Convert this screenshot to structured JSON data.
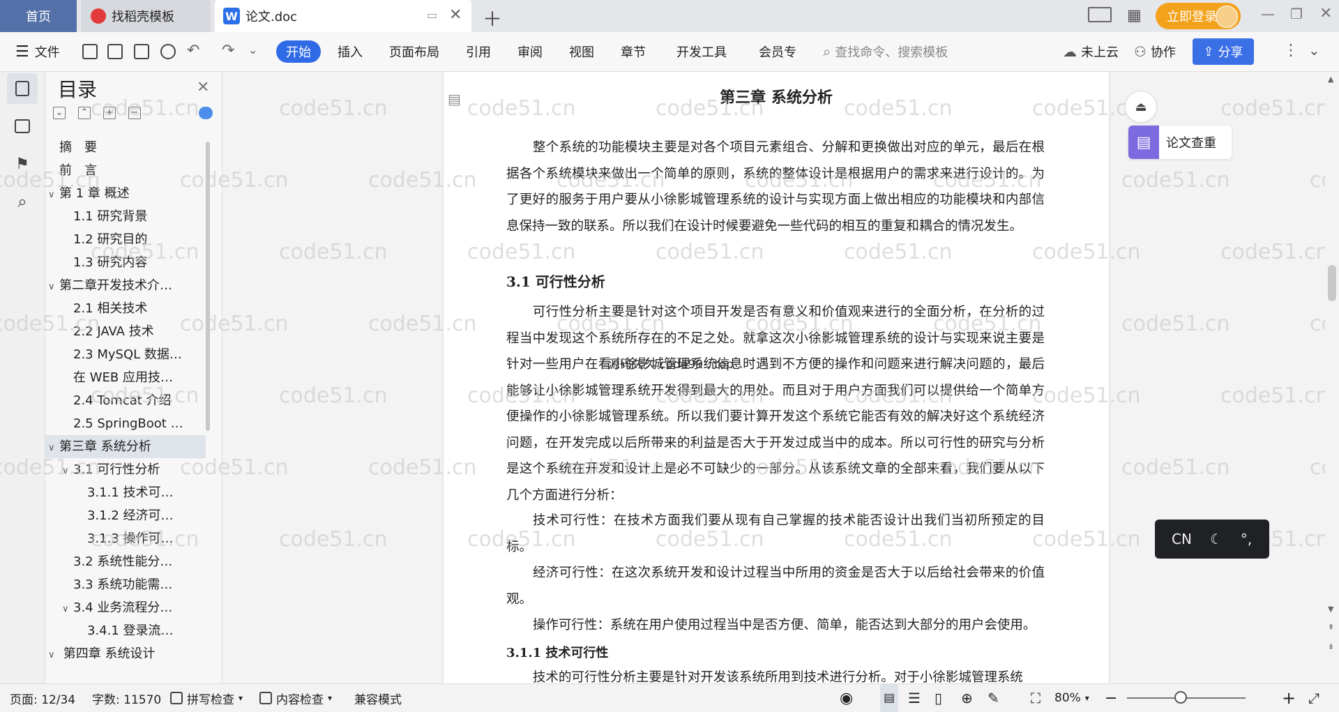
{
  "tabs": {
    "home": "首页",
    "template": "找稻壳模板",
    "doc": "论文.doc",
    "login": "立即登录"
  },
  "toolbar": {
    "file": "文件",
    "menus": [
      "开始",
      "插入",
      "页面布局",
      "引用",
      "审阅",
      "视图",
      "章节",
      "开发工具",
      "会员专"
    ],
    "search_placeholder": "查找命令、搜索模板",
    "cloud": "未上云",
    "collab": "协作",
    "share": "分享"
  },
  "toc": {
    "title": "目录",
    "items": [
      {
        "label": "摘　要",
        "level": 0,
        "caret": ""
      },
      {
        "label": "前　言",
        "level": 0,
        "caret": ""
      },
      {
        "label": "第 1 章  概述",
        "level": 0,
        "caret": "∨"
      },
      {
        "label": "1.1  研究背景",
        "level": 1,
        "caret": ""
      },
      {
        "label": "1.2  研究目的",
        "level": 1,
        "caret": ""
      },
      {
        "label": "1.3  研究内容",
        "level": 1,
        "caret": ""
      },
      {
        "label": "第二章开发技术介…",
        "level": 0,
        "caret": "∨"
      },
      {
        "label": "2.1 相关技术",
        "level": 1,
        "caret": ""
      },
      {
        "label": "2.2  JAVA 技术",
        "level": 1,
        "caret": ""
      },
      {
        "label": "2.3  MySQL 数据…",
        "level": 1,
        "caret": ""
      },
      {
        "label": "在 WEB 应用技…",
        "level": 1,
        "caret": ""
      },
      {
        "label": "2.4  Tomcat 介绍",
        "level": 1,
        "caret": ""
      },
      {
        "label": "2.5  SpringBoot …",
        "level": 1,
        "caret": ""
      },
      {
        "label": "第三章  系统分析",
        "level": 0,
        "caret": "∨",
        "selected": true
      },
      {
        "label": "3.1  可行性分析",
        "level": 1,
        "caret": "∨"
      },
      {
        "label": "3.1.1   技术可…",
        "level": 2,
        "caret": ""
      },
      {
        "label": "3.1.2  经济可…",
        "level": 2,
        "caret": ""
      },
      {
        "label": "3.1.3  操作可…",
        "level": 2,
        "caret": ""
      },
      {
        "label": "3.2  系统性能分…",
        "level": 1,
        "caret": ""
      },
      {
        "label": "3.3  系统功能需…",
        "level": 1,
        "caret": ""
      },
      {
        "label": "3.4  业务流程分…",
        "level": 1,
        "caret": "∨"
      },
      {
        "label": "3.4.1 登录流…",
        "level": 2,
        "caret": ""
      },
      {
        "label": " 第四章  系统设计",
        "level": 0,
        "caret": "∨"
      }
    ]
  },
  "document": {
    "title": "第三章  系统分析",
    "para1": "整个系统的功能模块主要是对各个项目元素组合、分解和更换做出对应的单元，最后在根据各个系统模块来做出一个简单的原则，系统的整体设计是根据用户的需求来进行设计的。为了更好的服务于用户要从小徐影城管理系统的设计与实现方面上做出相应的功能模块和内部信息保持一致的联系。所以我们在设计时候要避免一些代码的相互的重复和耦合的情况发生。",
    "heading1": "3.1  可行性分析",
    "para2": "可行性分析主要是针对这个项目开发是否有意义和价值观来进行的全面分析，在分析的过程当中发现这个系统所存在的不足之处。就拿这次小徐影城管理系统的设计与实现来说主要是针对一些用户在看小徐影城管理系统信息时遇到不方便的操作和问题来进行解决问题的，最后能够让小徐影城管理系统开发得到最大的用处。而且对于用户方面我们可以提供给一个简单方便操作的小徐影城管理系统。所以我们要计算开发这个系统它能否有效的解决好这个系统经济问题，在开发完成以后所带来的利益是否大于开发过成当中的成本。所以可行性的研究与分析是这个系统在开发和设计上是必不可缺少的一部分。从该系统文章的全部来看，我们要从以下几个方面进行分析：",
    "para3": "技术可行性：在技术方面我们要从现有自己掌握的技术能否设计出我们当初所预定的目标。",
    "para4": "经济可行性：在这次系统开发和设计过程当中所用的资金是否大于以后给社会带来的价值观。",
    "para5": "操作可行性：系统在用户使用过程当中是否方便、简单，能否达到大部分的用户会使用。",
    "heading2": "3.1.1   技术可行性",
    "para6": "技术的可行性分析主要是针对开发该系统所用到技术进行分析。对于小徐影城管理系统",
    "overlay": "源码久久 code99 . top",
    "watermark": "code51.cn"
  },
  "right_panel": {
    "check_label": "论文查重",
    "ime": "CN"
  },
  "status": {
    "page": "页面: 12/34",
    "words": "字数: 11570",
    "spell": "拼写检查",
    "content_check": "内容检查",
    "compat": "兼容模式",
    "zoom": "80%",
    "zoom_level": 0.45
  }
}
